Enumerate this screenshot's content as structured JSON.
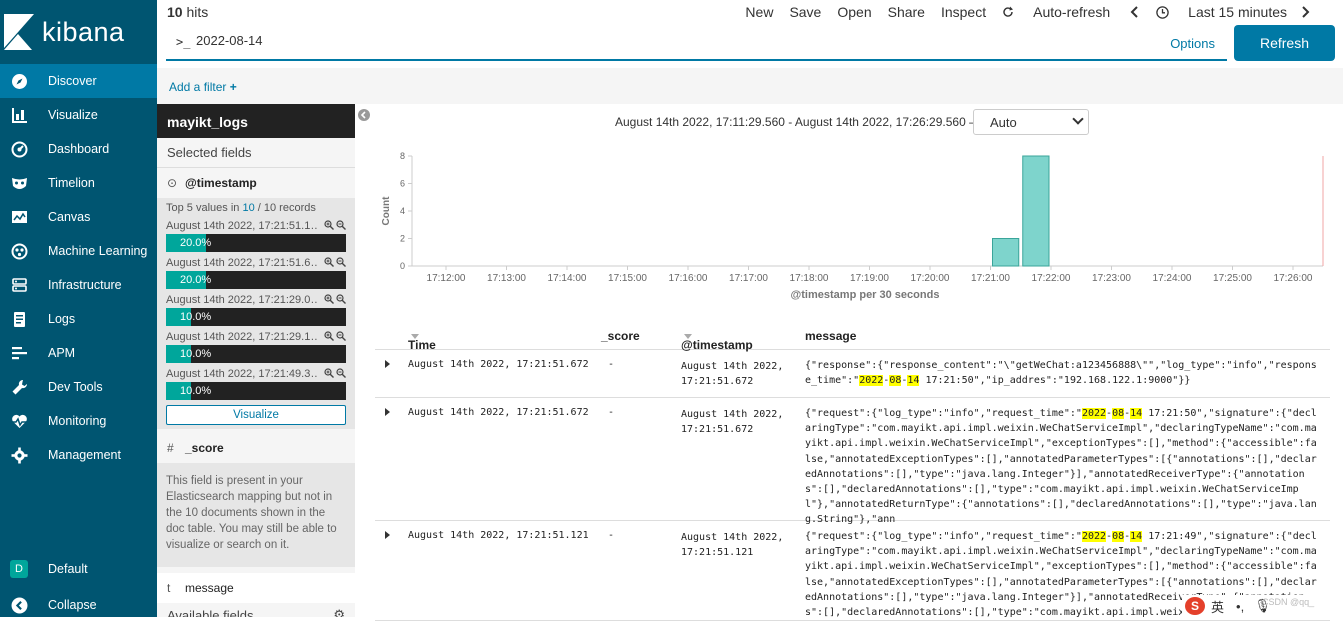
{
  "app": {
    "logo_text": "kibana"
  },
  "sidebar": {
    "items": [
      {
        "label": "Discover",
        "icon": "compass-icon",
        "active": true
      },
      {
        "label": "Visualize",
        "icon": "bar-chart-icon"
      },
      {
        "label": "Dashboard",
        "icon": "dashboard-gauge-icon"
      },
      {
        "label": "Timelion",
        "icon": "timelion-mask-icon"
      },
      {
        "label": "Canvas",
        "icon": "canvas-icon"
      },
      {
        "label": "Machine Learning",
        "icon": "machine-learning-icon"
      },
      {
        "label": "Infrastructure",
        "icon": "infrastructure-icon"
      },
      {
        "label": "Logs",
        "icon": "logs-icon"
      },
      {
        "label": "APM",
        "icon": "apm-icon"
      },
      {
        "label": "Dev Tools",
        "icon": "wrench-icon"
      },
      {
        "label": "Monitoring",
        "icon": "heartbeat-icon"
      },
      {
        "label": "Management",
        "icon": "gear-icon"
      }
    ],
    "space_badge": "D",
    "space_label": "Default",
    "collapse_label": "Collapse"
  },
  "topbar": {
    "hits_count": "10",
    "hits_label": "hits",
    "menu": [
      "New",
      "Save",
      "Open",
      "Share",
      "Inspect"
    ],
    "auto_refresh": "Auto-refresh",
    "time_label": "Last 15 minutes"
  },
  "query": {
    "prompt": ">_",
    "value": "2022-08-14",
    "options_label": "Options",
    "refresh_label": "Refresh"
  },
  "filter": {
    "add_label": "Add a filter"
  },
  "fields": {
    "index_name": "mayikt_logs",
    "selected_title": "Selected fields",
    "timestamp_field": {
      "type_icon": "⊙",
      "name": "@timestamp"
    },
    "top5": {
      "prefix": "Top 5 values in",
      "count": "10",
      "suffix": "/ 10 records"
    },
    "values": [
      {
        "text": "August 14th 2022, 17:21:51.1…",
        "pct_label": "20.0%",
        "pct": 0.2
      },
      {
        "text": "August 14th 2022, 17:21:51.6…",
        "pct_label": "20.0%",
        "pct": 0.2
      },
      {
        "text": "August 14th 2022, 17:21:29.0…",
        "pct_label": "10.0%",
        "pct": 0.1
      },
      {
        "text": "August 14th 2022, 17:21:29.1…",
        "pct_label": "10.0%",
        "pct": 0.1
      },
      {
        "text": "August 14th 2022, 17:21:49.3…",
        "pct_label": "10.0%",
        "pct": 0.1
      }
    ],
    "visualize_label": "Visualize",
    "score_field": {
      "type_icon": "#",
      "name": "_score"
    },
    "score_note": "This field is present in your Elasticsearch mapping but not in the 10 documents shown in the doc table. You may still be able to visualize or search on it.",
    "message_field": {
      "type_icon": "t",
      "name": "message"
    },
    "available_title": "Available fields"
  },
  "histogram": {
    "time_range": "August 14th 2022, 17:11:29.560 - August 14th 2022, 17:26:29.560 —",
    "interval": "Auto"
  },
  "chart_data": {
    "type": "bar",
    "ylabel": "Count",
    "xlabel": "@timestamp per 30 seconds",
    "ylim": [
      0,
      8
    ],
    "yticks": [
      0,
      2,
      4,
      6,
      8
    ],
    "xticks": [
      "17:12:00",
      "17:13:00",
      "17:14:00",
      "17:15:00",
      "17:16:00",
      "17:17:00",
      "17:18:00",
      "17:19:00",
      "17:20:00",
      "17:21:00",
      "17:22:00",
      "17:23:00",
      "17:24:00",
      "17:25:00",
      "17:26:00"
    ],
    "categories": [
      "17:21:00",
      "17:21:30"
    ],
    "values": [
      2,
      8
    ],
    "bar_color": "#7ed4cc"
  },
  "table": {
    "headers": {
      "time": "Time",
      "score": "_score",
      "timestamp": "@timestamp",
      "message": "message"
    },
    "rows": [
      {
        "time": "August 14th 2022, 17:21:51.672",
        "score": "-",
        "timestamp": "August 14th 2022, 17:21:51.672",
        "message": "{\"response\":{\"response_content\":\"\\\"getWeChat:a123456888\\\"\",\"log_type\":\"info\",\"response_time\":\"⟦2022⟧-⟦08⟧-⟦14⟧ 17:21:50\",\"ip_addres\":\"192.168.122.1:9000\"}}"
      },
      {
        "time": "August 14th 2022, 17:21:51.672",
        "score": "-",
        "timestamp": "August 14th 2022, 17:21:51.672",
        "message": "{\"request\":{\"log_type\":\"info\",\"request_time\":\"⟦2022⟧-⟦08⟧-⟦14⟧ 17:21:50\",\"signature\":{\"declaringType\":\"com.mayikt.api.impl.weixin.WeChatServiceImpl\",\"declaringTypeName\":\"com.mayikt.api.impl.weixin.WeChatServiceImpl\",\"exceptionTypes\":[],\"method\":{\"accessible\":false,\"annotatedExceptionTypes\":[],\"annotatedParameterTypes\":[{\"annotations\":[],\"declaredAnnotations\":[],\"type\":\"java.lang.Integer\"}],\"annotatedReceiverType\":{\"annotations\":[],\"declaredAnnotations\":[],\"type\":\"com.mayikt.api.impl.weixin.WeChatServiceImpl\"},\"annotatedReturnType\":{\"annotations\":[],\"declaredAnnotations\":[],\"type\":\"java.lang.String\"},\"ann"
      },
      {
        "time": "August 14th 2022, 17:21:51.121",
        "score": "-",
        "timestamp": "August 14th 2022, 17:21:51.121",
        "message": "{\"request\":{\"log_type\":\"info\",\"request_time\":\"⟦2022⟧-⟦08⟧-⟦14⟧ 17:21:49\",\"signature\":{\"declaringType\":\"com.mayikt.api.impl.weixin.WeChatServiceImpl\",\"declaringTypeName\":\"com.mayikt.api.impl.weixin.WeChatServiceImpl\",\"exceptionTypes\":[],\"method\":{\"accessible\":false,\"annotatedExceptionTypes\":[],\"annotatedParameterTypes\":[{\"annotations\":[],\"declaredAnnotations\":[],\"type\":\"java.lang.Integer\"}],\"annotatedReceiverType\":{\"annotations\":[],\"declaredAnnotations\":[],\"type\":\"com.mayikt.api.impl.weixin.WeChat"
      }
    ]
  },
  "overlay": {
    "watermark": "CSDN @qq_",
    "ime_label": "英"
  },
  "colors": {
    "sidebar": "#005571",
    "active": "#0079a5",
    "accent": "#00a69b",
    "highlight": "#ffff00"
  }
}
